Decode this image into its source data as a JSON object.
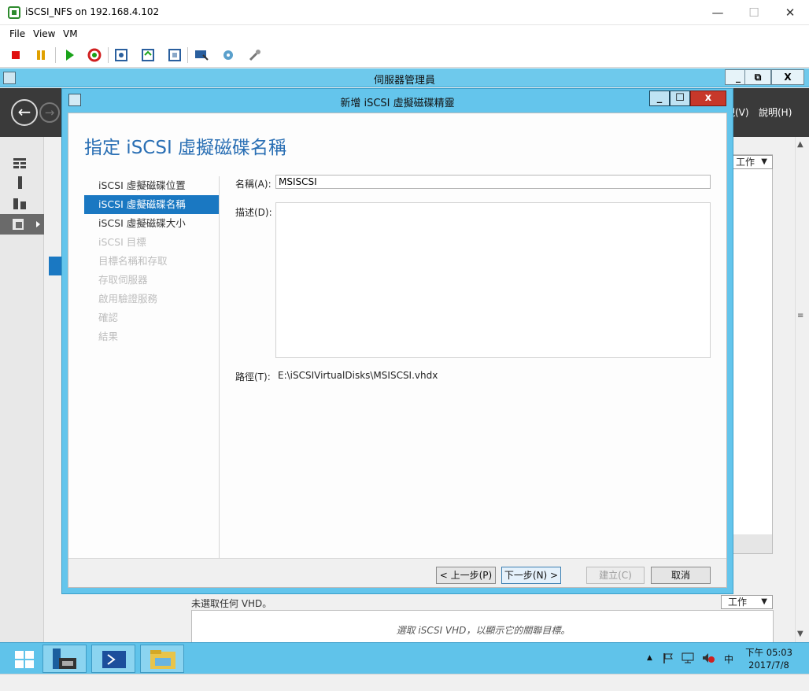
{
  "outer_window": {
    "title": "iSCSI_NFS on 192.168.4.102",
    "minimize": "—",
    "maximize": "☐",
    "close": "✕"
  },
  "menubar": {
    "file": "File",
    "view": "View",
    "vm": "VM"
  },
  "server_manager": {
    "title": "伺服器管理員",
    "min": "_",
    "restore": "⧉",
    "close": "X",
    "back": "←",
    "forward": "→",
    "menu_view": "檢視(V)",
    "menu_help": "說明(H)",
    "tasks_label": "工作",
    "vhd_status": "未選取任何 VHD。",
    "vhd_hint": "選取 iSCSI VHD，以顯示它的關聯目標。"
  },
  "wizard": {
    "title": "新增 iSCSI 虛擬磁碟精靈",
    "min": "_",
    "max": "☐",
    "close": "x",
    "heading": "指定 iSCSI 虛擬磁碟名稱",
    "steps": [
      {
        "label": "iSCSI 虛擬磁碟位置",
        "state": "done"
      },
      {
        "label": "iSCSI 虛擬磁碟名稱",
        "state": "active"
      },
      {
        "label": "iSCSI 虛擬磁碟大小",
        "state": "enabled"
      },
      {
        "label": "iSCSI 目標",
        "state": "disabled"
      },
      {
        "label": "目標名稱和存取",
        "state": "disabled"
      },
      {
        "label": "存取伺服器",
        "state": "disabled"
      },
      {
        "label": "啟用驗證服務",
        "state": "disabled"
      },
      {
        "label": "確認",
        "state": "disabled"
      },
      {
        "label": "結果",
        "state": "disabled"
      }
    ],
    "name_label": "名稱(A):",
    "name_value": "MSISCSI",
    "desc_label": "描述(D):",
    "path_label": "路徑(T):",
    "path_value": "E:\\iSCSIVirtualDisks\\MSISCSI.vhdx",
    "buttons": {
      "prev": "< 上一步(P)",
      "next": "下一步(N) >",
      "create": "建立(C)",
      "cancel": "取消"
    }
  },
  "taskbar": {
    "clock_time": "下午 05:03",
    "clock_date": "2017/7/8",
    "ime": "中"
  },
  "colors": {
    "wizard_frame": "#64c5ec",
    "selected_step": "#1a78c2",
    "heading": "#2a6fb4",
    "nav_bar": "#3a3a3a"
  }
}
